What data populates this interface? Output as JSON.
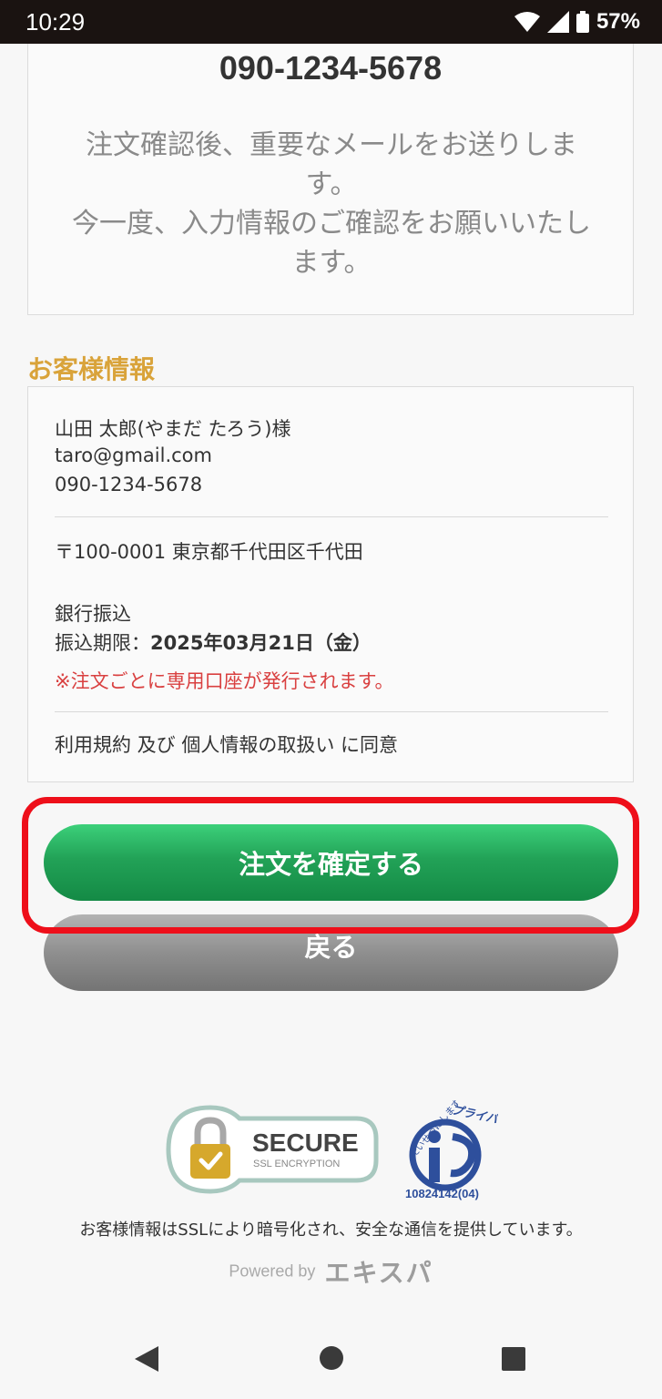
{
  "status_bar": {
    "time": "10:29",
    "battery": "57%"
  },
  "notice": {
    "phone": "090-1234-5678",
    "lines": [
      "注文確認後、重要なメールをお送りしま",
      "す。",
      "今一度、入力情報のご確認をお願いいたし",
      "ます。"
    ]
  },
  "customer": {
    "section_title": "お客様情報",
    "name": "山田 太郎(やまだ たろう)様",
    "email": "taro@gmail.com",
    "phone": "090-1234-5678",
    "address": "〒100-0001 東京都千代田区千代田",
    "payment_method": "銀行振込",
    "deadline_label": "振込期限：",
    "deadline_value": "2025年03月21日（金）",
    "account_note": "※注文ごとに専用口座が発行されます。",
    "agreement": "利用規約 及び 個人情報の取扱い に同意"
  },
  "buttons": {
    "confirm": "注文を確定する",
    "back": "戻る"
  },
  "footer": {
    "secure_title": "SECURE",
    "secure_sub": "SSL ENCRYPTION",
    "privacy_top": "たいせつにします",
    "privacy_word": "プライバシー",
    "privacy_number": "10824142(04)",
    "ssl_note": "お客様情報はSSLにより暗号化され、安全な通信を提供しています。",
    "powered_by": "Powered by",
    "brand": "エキスパ"
  },
  "colors": {
    "accent_gold": "#d9a33a",
    "confirm_green": "#22a257",
    "warning_red": "#d94040",
    "highlight_red": "#ee0f1a"
  }
}
